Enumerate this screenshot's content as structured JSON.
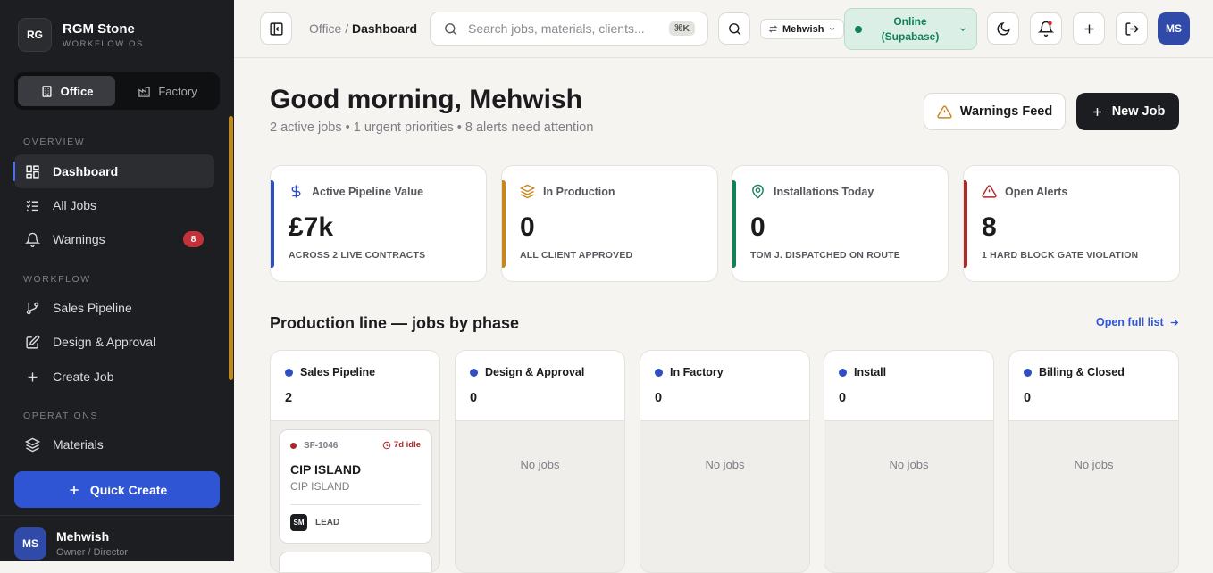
{
  "brand": {
    "logo": "RG",
    "name": "RGM Stone",
    "sub": "WORKFLOW OS"
  },
  "modes": [
    {
      "label": "Office",
      "icon": "building-icon",
      "active": true
    },
    {
      "label": "Factory",
      "icon": "factory-icon",
      "active": false
    }
  ],
  "sections": {
    "overview": "OVERVIEW",
    "workflow": "WORKFLOW",
    "operations": "OPERATIONS"
  },
  "nav": {
    "dashboard": "Dashboard",
    "all_jobs": "All Jobs",
    "warnings": "Warnings",
    "warnings_badge": "8",
    "sales_pipeline": "Sales Pipeline",
    "design_approval": "Design & Approval",
    "create_job": "Create Job",
    "materials": "Materials"
  },
  "quick_create": "Quick Create",
  "user": {
    "initials": "MS",
    "name": "Mehwish",
    "role": "Owner / Director"
  },
  "topbar": {
    "breadcrumb_parent": "Office",
    "breadcrumb_sep": " / ",
    "breadcrumb_current": "Dashboard",
    "search_placeholder": "Search jobs, materials, clients...",
    "search_shortcut": "⌘K",
    "user_select": "Mehwish",
    "status_line1": "Online",
    "status_line2": "(Supabase)",
    "avatar": "MS"
  },
  "greeting": "Good morning, Mehwish",
  "summary": "2 active jobs • 1 urgent priorities • 8 alerts need attention",
  "actions": {
    "warnings_feed": "Warnings Feed",
    "new_job": "New Job"
  },
  "stats": [
    {
      "label": "Active Pipeline Value",
      "value": "£7k",
      "caption": "ACROSS 2 LIVE CONTRACTS",
      "color": "#2f4ec2",
      "icon": "dollar-icon"
    },
    {
      "label": "In Production",
      "value": "0",
      "caption": "ALL CLIENT APPROVED",
      "color": "#c8861e",
      "icon": "layers-icon"
    },
    {
      "label": "Installations Today",
      "value": "0",
      "caption": "TOM J. DISPATCHED ON ROUTE",
      "color": "#128156",
      "icon": "map-pin-icon"
    },
    {
      "label": "Open Alerts",
      "value": "8",
      "caption": "1 HARD BLOCK GATE VIOLATION",
      "color": "#b12a2a",
      "icon": "alert-triangle-icon"
    }
  ],
  "production": {
    "title": "Production line — jobs by phase",
    "open_full": "Open full list",
    "empty_label": "No jobs",
    "columns": [
      {
        "name": "Sales Pipeline",
        "count": "2"
      },
      {
        "name": "Design & Approval",
        "count": "0"
      },
      {
        "name": "In Factory",
        "count": "0"
      },
      {
        "name": "Install",
        "count": "0"
      },
      {
        "name": "Billing & Closed",
        "count": "0"
      }
    ],
    "job": {
      "id": "SF-1046",
      "idle": "7d idle",
      "title": "CIP ISLAND",
      "client": "CIP ISLAND",
      "owner": "SM",
      "stage": "LEAD"
    }
  }
}
